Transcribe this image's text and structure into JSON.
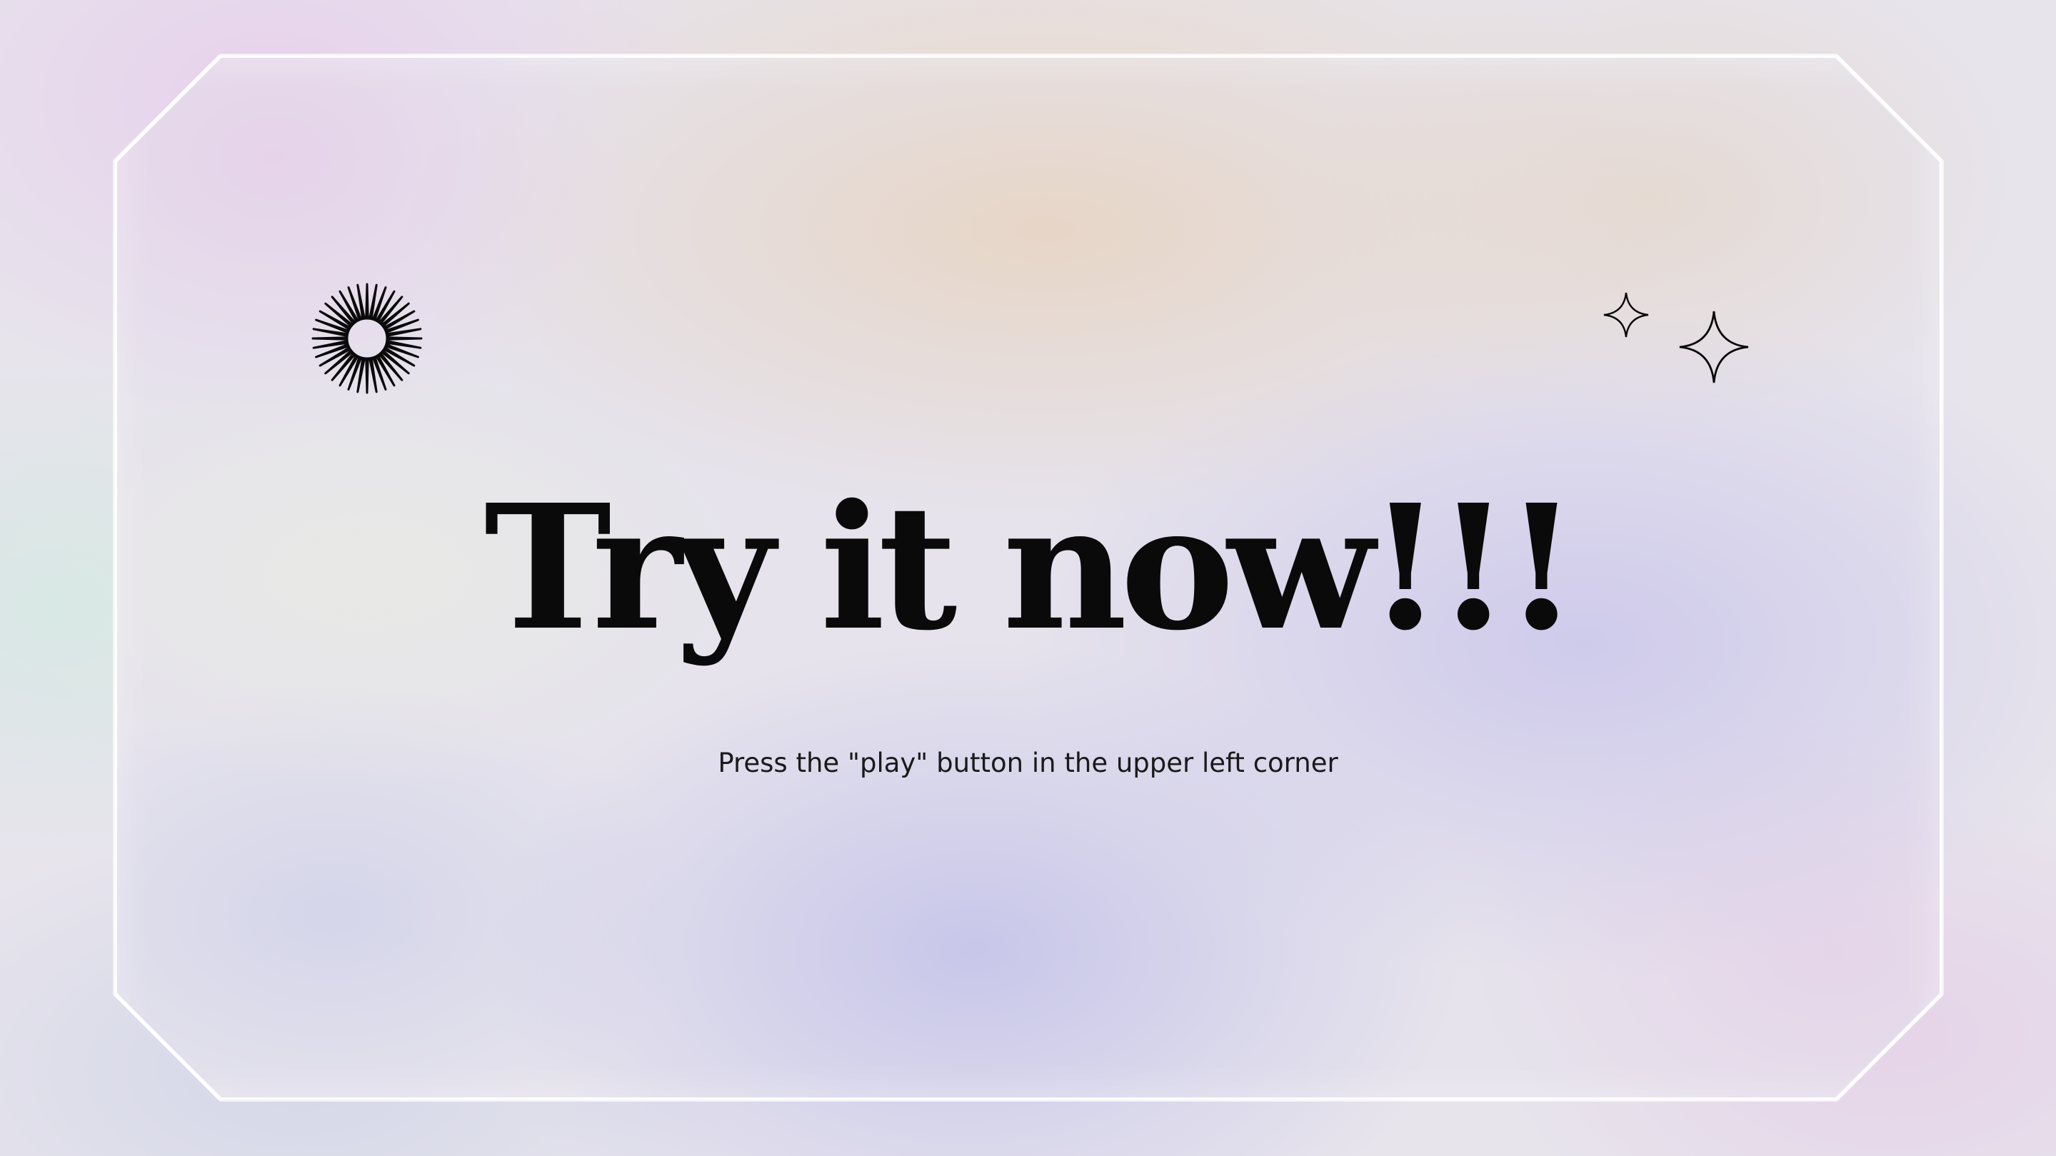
{
  "slide": {
    "title": "Try it now!!!",
    "subtitle": "Press the \"play\" button in the upper left corner"
  },
  "icons": {
    "sunburst": "sunburst-icon",
    "sparkle_small": "four-point-star-icon",
    "sparkle_large": "four-point-star-icon"
  },
  "colors": {
    "text": "#0a0a0a",
    "panel_border": "#ffffff",
    "lavender": "#c8c6ea",
    "peach": "#e7d5c5",
    "pink": "#e6d2ea"
  }
}
